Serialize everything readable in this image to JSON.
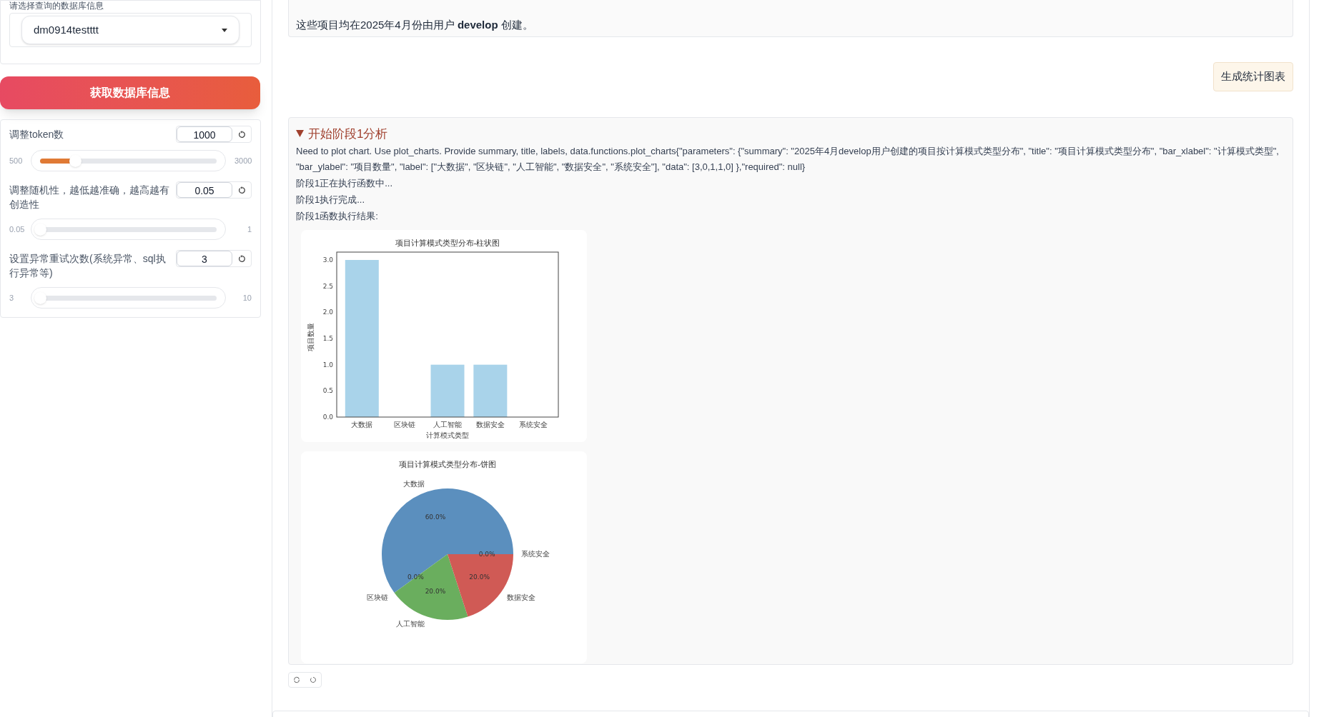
{
  "sidebar": {
    "database_label": "请选择查询的数据库信息",
    "database_select": {
      "value": "dm0914testttt"
    },
    "fetch_button": "获取数据库信息",
    "settings": [
      {
        "label": "调整token数",
        "value": "1000",
        "min": "500",
        "max": "3000",
        "level": 0.2
      },
      {
        "label": "调整随机性，越低越准确，越高越有创造性",
        "value": "0.05",
        "min": "0.05",
        "max": "1",
        "level": 0
      },
      {
        "label": "设置异常重试次数(系统异常、sql执行异常等)",
        "value": "3",
        "min": "3",
        "max": "10",
        "level": 0
      }
    ]
  },
  "chat": {
    "messages": [
      {
        "kind": "bot",
        "text": "这些项目均在2025年4月份由用户 **develop** 创建。"
      },
      {
        "kind": "user",
        "text": "生成统计图表"
      },
      {
        "kind": "analysis",
        "title": "开始阶段1分析",
        "expanded": true,
        "lines": [
          "Need to plot chart. Use plot_charts. Provide summary, title, labels, data.functions.plot_charts{\"parameters\": {\"summary\": \"2025年4月develop用户创建的项目按计算模式类型分布\", \"title\": \"项目计算模式类型分布\", \"bar_xlabel\": \"计算模式类型\", \"bar_ylabel\": \"项目数量\", \"label\": [\"大数据\", \"区块链\", \"人工智能\", \"数据安全\", \"系统安全\"], \"data\": [3,0,1,1,0] },\"required\": null}",
          "阶段1正在执行函数中...",
          "阶段1执行完成...",
          "阶段1函数执行结果:"
        ],
        "charts": [
          {
            "chart_data": {
              "type": "bar",
              "title": "项目计算模式类型分布-柱状图",
              "xlabel": "计算模式类型",
              "ylabel": "项目数量",
              "categories": [
                "大数据",
                "区块链",
                "人工智能",
                "数据安全",
                "系统安全"
              ],
              "values": [
                3,
                0,
                1,
                1,
                0
              ],
              "ylim": [
                0,
                3.15
              ],
              "yticks": [
                {
                  "value": 0,
                  "label": "0.0"
                },
                {
                  "value": 0.5,
                  "label": "0.5"
                },
                {
                  "value": 1,
                  "label": "1.0"
                },
                {
                  "value": 1.5,
                  "label": "1.5"
                },
                {
                  "value": 2,
                  "label": "2.0"
                },
                {
                  "value": 2.5,
                  "label": "2.5"
                },
                {
                  "value": 3,
                  "label": "3.0"
                }
              ]
            }
          },
          {
            "chart_data": {
              "type": "pie",
              "title": "项目计算模式类型分布-饼图",
              "categories": [
                "大数据",
                "区块链",
                "人工智能",
                "数据安全",
                "系统安全"
              ],
              "values": [
                60,
                0,
                20,
                20,
                0
              ],
              "value_labels": [
                "60.0%",
                "0.0%",
                "20.0%",
                "20.0%",
                "0.0%"
              ]
            }
          }
        ]
      }
    ]
  }
}
